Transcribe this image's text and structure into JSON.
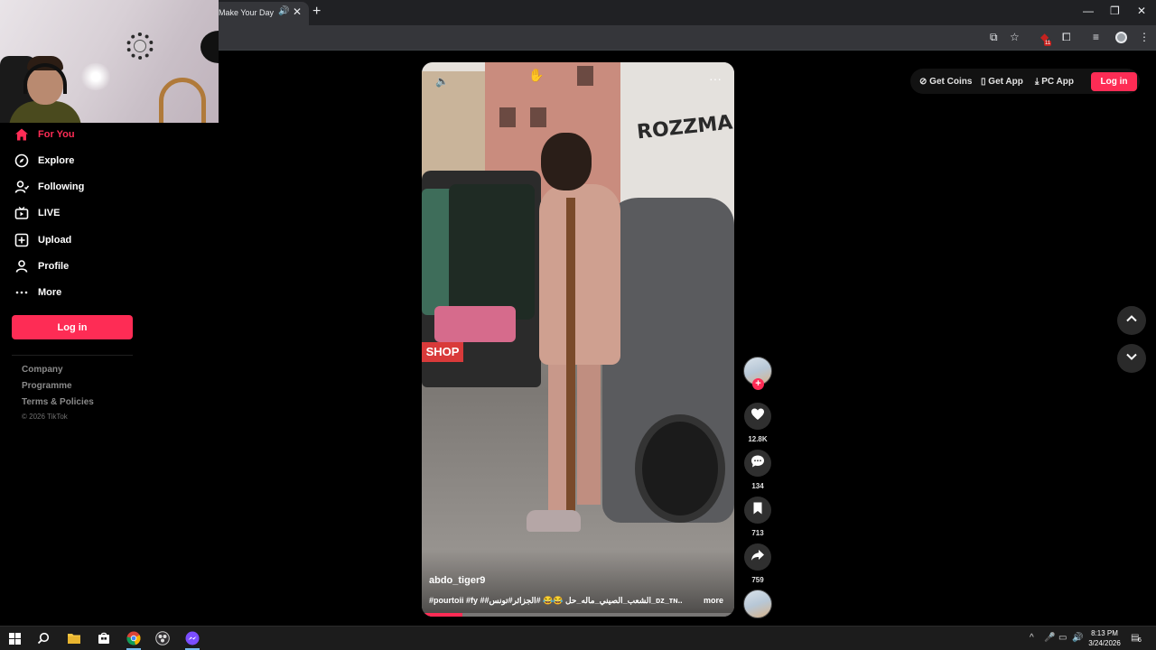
{
  "browser": {
    "tab_title": "Make Your Day",
    "new_tab": "+",
    "extension_badge": "11"
  },
  "sidebar": {
    "items": [
      {
        "label": "For You",
        "icon": "home-icon",
        "active": true
      },
      {
        "label": "Explore",
        "icon": "compass-icon"
      },
      {
        "label": "Following",
        "icon": "following-icon"
      },
      {
        "label": "LIVE",
        "icon": "live-icon"
      },
      {
        "label": "Upload",
        "icon": "upload-icon"
      },
      {
        "label": "Profile",
        "icon": "profile-icon"
      },
      {
        "label": "More",
        "icon": "more-icon"
      }
    ],
    "login_label": "Log in",
    "footer": {
      "company": "Company",
      "programme": "Programme",
      "terms": "Terms & Policies",
      "copyright": "© 2026 TikTok"
    }
  },
  "header": {
    "get_coins": "Get Coins",
    "get_app": "Get App",
    "pc_app": "PC App",
    "login_label": "Log in"
  },
  "video": {
    "author": "abdo_tiger9",
    "caption": "#pourtoii #fy ##الشعب_الصيني_ماله_حل 😂😂 #الجزائر#تونس_ᴅᴢ_ᴛɴ...",
    "more_label": "more",
    "graffiti": "ROZZMA",
    "shop_sign": "SHOP",
    "progress": 0.13
  },
  "actions": {
    "likes": "12.8K",
    "comments": "134",
    "saves": "713",
    "shares": "759"
  },
  "taskbar": {
    "time": "8:13 PM",
    "date": "3/24/2026",
    "notifications": "6"
  },
  "colors": {
    "accent": "#fe2c55",
    "background": "#000000"
  }
}
